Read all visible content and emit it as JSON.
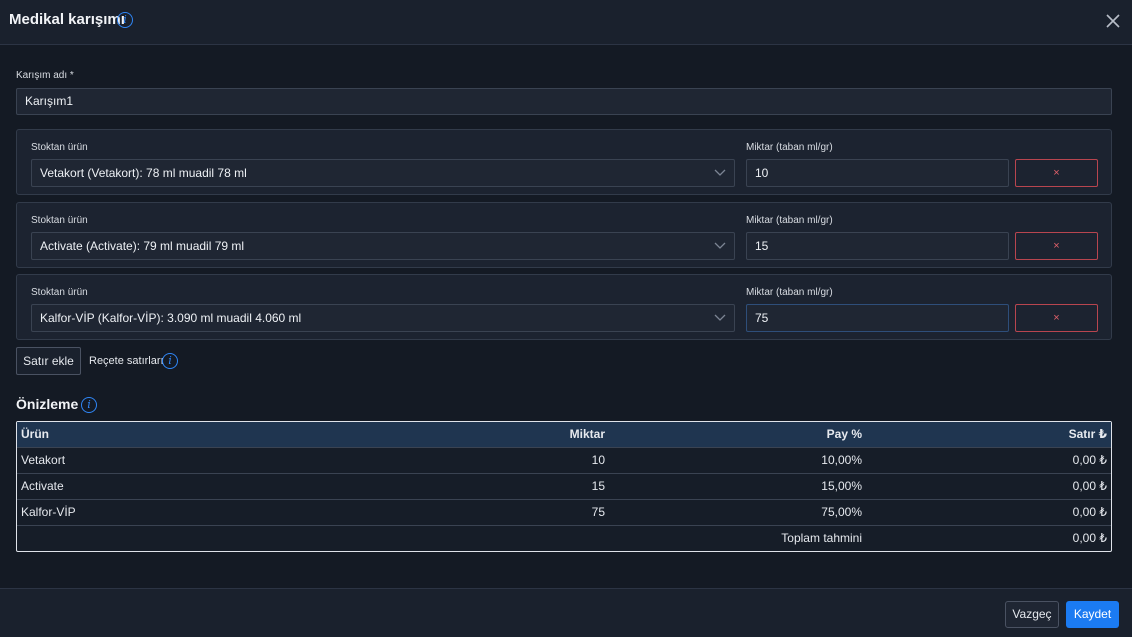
{
  "header": {
    "title": "Medikal karışımı",
    "info_glyph": "i"
  },
  "mix_name": {
    "label": "Karışım adı *",
    "value": "Karışım1"
  },
  "rows": [
    {
      "product_label": "Stoktan ürün",
      "product_value": "Vetakort (Vetakort): 78 ml muadil 78 ml",
      "qty_label": "Miktar (taban ml/gr)",
      "qty_value": "10",
      "remove_label": "×"
    },
    {
      "product_label": "Stoktan ürün",
      "product_value": "Activate (Activate): 79 ml muadil 79 ml",
      "qty_label": "Miktar (taban ml/gr)",
      "qty_value": "15",
      "remove_label": "×"
    },
    {
      "product_label": "Stoktan ürün",
      "product_value": "Kalfor-VİP (Kalfor-VİP): 3.090 ml muadil 4.060 ml",
      "qty_label": "Miktar (taban ml/gr)",
      "qty_value": "75",
      "remove_label": "×"
    }
  ],
  "actions": {
    "add_row_label": "Satır ekle",
    "recipe_lines_label": "Reçete satırları"
  },
  "preview": {
    "title": "Önizleme",
    "columns": [
      "Ürün",
      "Miktar",
      "Pay %",
      "Satır ₺"
    ],
    "rows": [
      [
        "Vetakort",
        "10",
        "10,00%",
        "0,00 ₺"
      ],
      [
        "Activate",
        "15",
        "15,00%",
        "0,00 ₺"
      ],
      [
        "Kalfor-VİP",
        "75",
        "75,00%",
        "0,00 ₺"
      ]
    ],
    "total_label": "Toplam tahmini",
    "total_value": "0,00 ₺"
  },
  "footer": {
    "cancel_label": "Vazgeç",
    "save_label": "Kaydet"
  },
  "colors": {
    "accent": "#1b7bf2",
    "danger": "#e0606a",
    "background": "#141a24"
  }
}
